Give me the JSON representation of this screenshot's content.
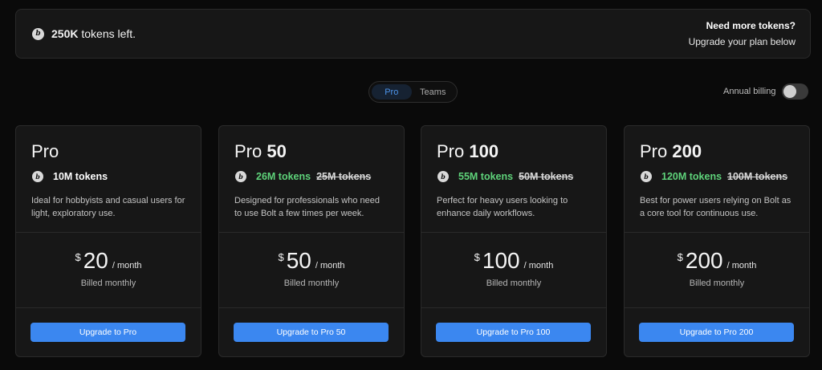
{
  "banner": {
    "tokens_amount": "250K",
    "tokens_suffix": " tokens left.",
    "need_more": "Need more tokens?",
    "upgrade_below": "Upgrade your plan below"
  },
  "tabs": [
    {
      "label": "Pro",
      "active": true
    },
    {
      "label": "Teams",
      "active": false
    }
  ],
  "annual_billing": {
    "label": "Annual billing",
    "enabled": false
  },
  "icons": {
    "token": "bolt-b-icon"
  },
  "colors": {
    "accent": "#3b87f0",
    "green": "#5ed37a",
    "active_tab_text": "#4d94ea"
  },
  "plans": [
    {
      "name_base": "Pro",
      "name_bold": "",
      "tokens": "10M tokens",
      "old_tokens": "",
      "description": "Ideal for hobbyists and casual users for light, exploratory use.",
      "currency": "$",
      "price": "20",
      "period": "/ month",
      "billed": "Billed monthly",
      "cta": "Upgrade to Pro"
    },
    {
      "name_base": "Pro",
      "name_bold": "50",
      "tokens": "26M tokens",
      "old_tokens": "25M tokens",
      "description": "Designed for professionals who need to use Bolt a few times per week.",
      "currency": "$",
      "price": "50",
      "period": "/ month",
      "billed": "Billed monthly",
      "cta": "Upgrade to Pro 50"
    },
    {
      "name_base": "Pro",
      "name_bold": "100",
      "tokens": "55M tokens",
      "old_tokens": "50M tokens",
      "description": "Perfect for heavy users looking to enhance daily workflows.",
      "currency": "$",
      "price": "100",
      "period": "/ month",
      "billed": "Billed monthly",
      "cta": "Upgrade to Pro 100"
    },
    {
      "name_base": "Pro",
      "name_bold": "200",
      "tokens": "120M tokens",
      "old_tokens": "100M tokens",
      "description": "Best for power users relying on Bolt as a core tool for continuous use.",
      "currency": "$",
      "price": "200",
      "period": "/ month",
      "billed": "Billed monthly",
      "cta": "Upgrade to Pro 200"
    }
  ]
}
